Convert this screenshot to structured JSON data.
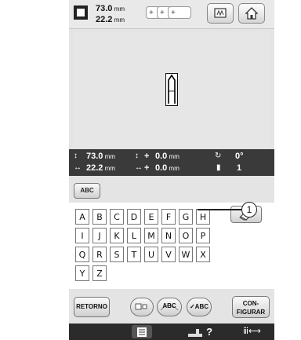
{
  "header": {
    "width_value": "73.0",
    "height_value": "22.2",
    "unit": "mm"
  },
  "zoom": {
    "labels": [
      "+",
      "+",
      "+"
    ]
  },
  "info": {
    "height": "73.0",
    "width": "22.2",
    "vertical_offset": "0.0",
    "horizontal_offset": "0.0",
    "unit": "mm",
    "rotation": "0°",
    "thread_count": "1",
    "plus": "+"
  },
  "font_button": {
    "label": "ABC"
  },
  "keyboard": {
    "rows": [
      [
        "A",
        "B",
        "C",
        "D",
        "E",
        "F",
        "G",
        "H"
      ],
      [
        "I",
        "J",
        "K",
        "L",
        "M",
        "N",
        "O",
        "P"
      ],
      [
        "Q",
        "R",
        "S",
        "T",
        "U",
        "V",
        "W",
        "X"
      ],
      [
        "Y",
        "Z"
      ]
    ]
  },
  "buttons": {
    "return": "RETORNO",
    "check_abc": "✓ABC",
    "abc_arc": "ABC",
    "configure_line1": "CON-",
    "configure_line2": "FIGURAR"
  },
  "status": {
    "help": "?"
  },
  "callout": {
    "number": "1"
  },
  "colors": {
    "screen_bg": "#e4e4e4",
    "info_bar": "#3a3a3a",
    "status_bar": "#2b2b2b"
  },
  "icons": [
    "size-icon",
    "memory-card-icon",
    "home-icon",
    "eraser-icon",
    "arrangement-icon",
    "arc-text-icon",
    "list-icon",
    "sewing-machine-icon",
    "needle-arrow-icon"
  ]
}
